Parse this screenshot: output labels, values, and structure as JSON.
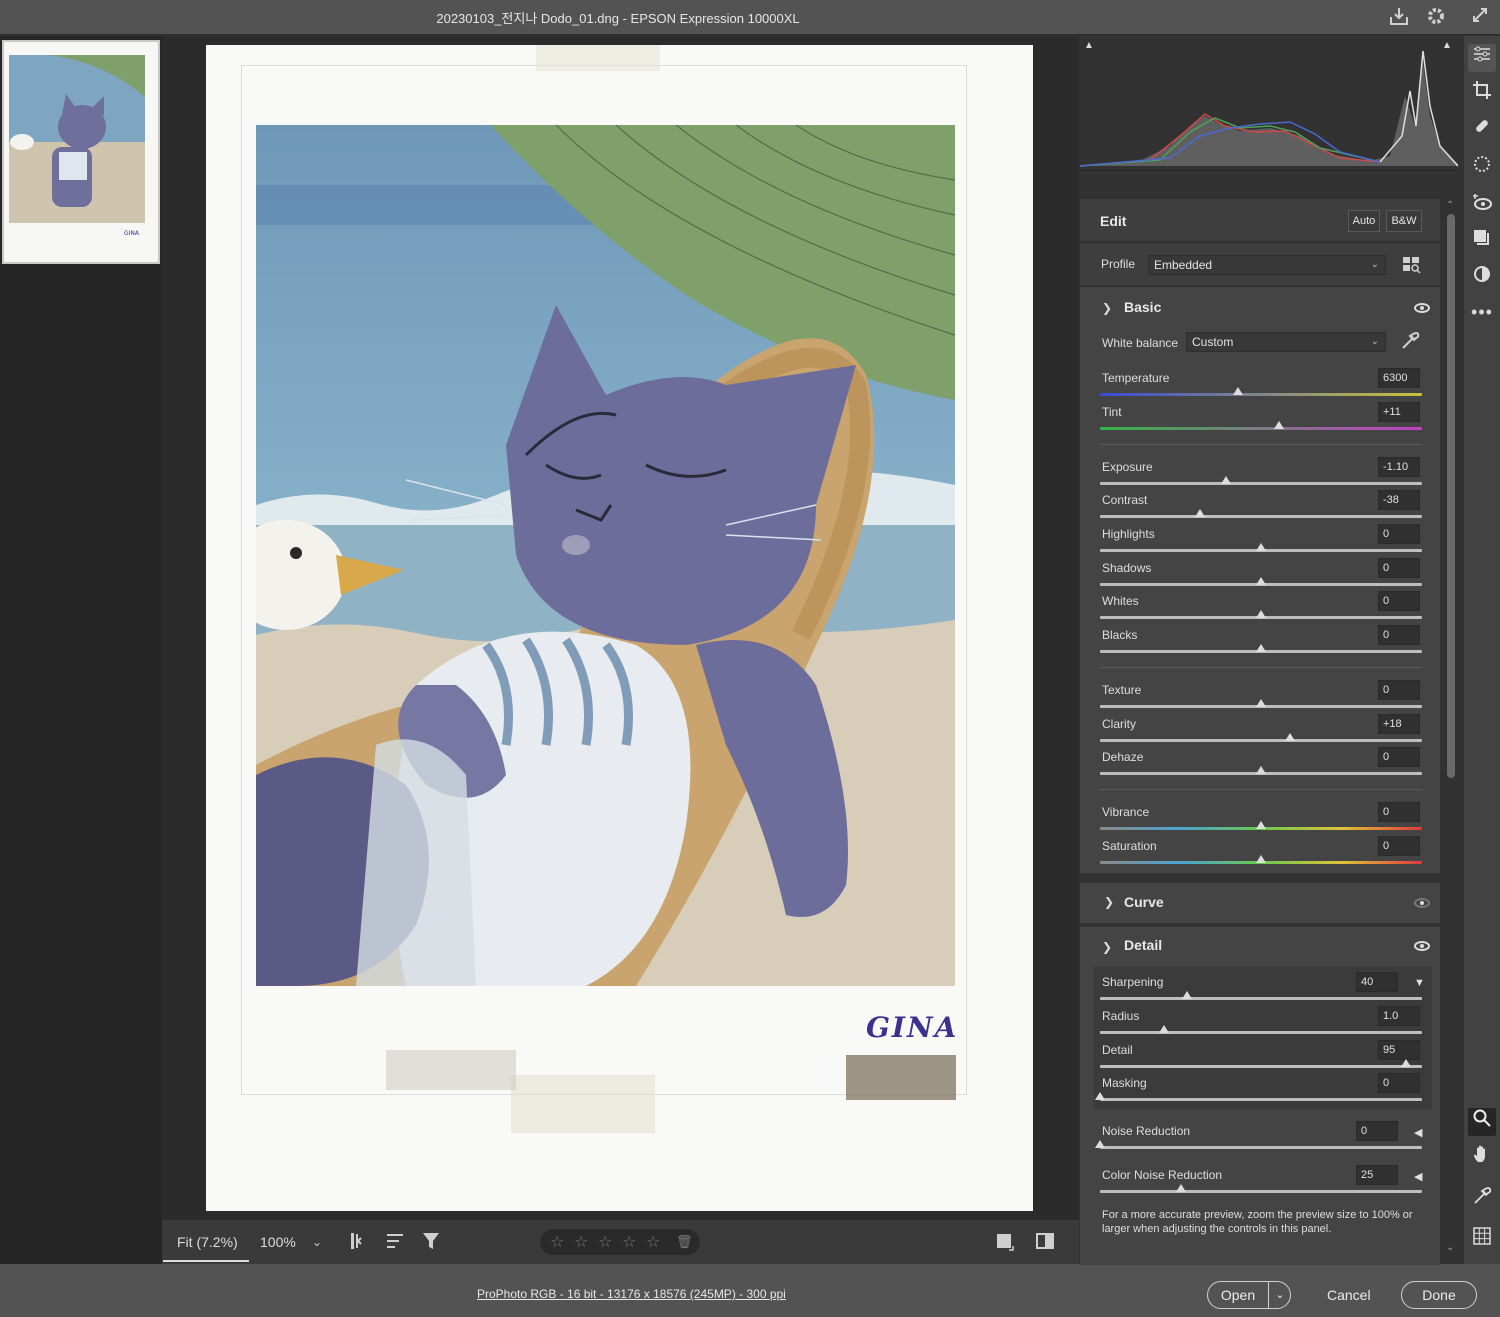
{
  "window": {
    "title": "20230103_전지나 Dodo_01.dng  -  EPSON Expression 10000XL"
  },
  "canvas": {
    "signature": "GINA"
  },
  "viewbar": {
    "fit_label": "Fit (7.2%)",
    "zoom_label": "100%",
    "rating_stars": 0
  },
  "status": {
    "color_info": "ProPhoto RGB - 16 bit - 13176 x 18576 (245MP) - 300 ppi",
    "open_label": "Open",
    "cancel_label": "Cancel",
    "done_label": "Done"
  },
  "edit": {
    "title": "Edit",
    "auto_label": "Auto",
    "bw_label": "B&W",
    "profile_label": "Profile",
    "profile_value": "Embedded"
  },
  "basic": {
    "title": "Basic",
    "white_balance_label": "White balance",
    "white_balance_value": "Custom",
    "sliders": [
      {
        "label": "Temperature",
        "value": "6300",
        "pos": 0.43
      },
      {
        "label": "Tint",
        "value": "+11",
        "pos": 0.555
      },
      {
        "label": "Exposure",
        "value": "-1.10",
        "pos": 0.39
      },
      {
        "label": "Contrast",
        "value": "-38",
        "pos": 0.31
      },
      {
        "label": "Highlights",
        "value": "0",
        "pos": 0.5
      },
      {
        "label": "Shadows",
        "value": "0",
        "pos": 0.5
      },
      {
        "label": "Whites",
        "value": "0",
        "pos": 0.5
      },
      {
        "label": "Blacks",
        "value": "0",
        "pos": 0.5
      },
      {
        "label": "Texture",
        "value": "0",
        "pos": 0.5
      },
      {
        "label": "Clarity",
        "value": "+18",
        "pos": 0.59
      },
      {
        "label": "Dehaze",
        "value": "0",
        "pos": 0.5
      },
      {
        "label": "Vibrance",
        "value": "0",
        "pos": 0.5
      },
      {
        "label": "Saturation",
        "value": "0",
        "pos": 0.5
      }
    ]
  },
  "curve": {
    "title": "Curve"
  },
  "detail": {
    "title": "Detail",
    "sliders": [
      {
        "label": "Sharpening",
        "value": "40",
        "pos": 0.27
      },
      {
        "label": "Radius",
        "value": "1.0",
        "pos": 0.2
      },
      {
        "label": "Detail",
        "value": "95",
        "pos": 0.95
      },
      {
        "label": "Masking",
        "value": "0",
        "pos": 0.0
      },
      {
        "label": "Noise Reduction",
        "value": "0",
        "pos": 0.0
      },
      {
        "label": "Color Noise Reduction",
        "value": "25",
        "pos": 0.25
      }
    ],
    "note": "For a more accurate preview, zoom the preview size to 100% or larger when adjusting the controls in this panel."
  },
  "colors": {
    "accent": "#ffffff",
    "panel": "#444444",
    "sky": "#7fa6c1",
    "umbrella": "#7fa06a",
    "cat": "#6e6f9a"
  },
  "icons": [
    "save-icon",
    "gear-icon",
    "expand-icon",
    "edit-sliders-icon",
    "crop-icon",
    "healing-icon",
    "masking-icon",
    "redeye-icon",
    "snapshots-icon",
    "presets-icon",
    "more-icon",
    "zoom-icon",
    "hand-icon",
    "color-sampler-icon",
    "grid-icon"
  ]
}
